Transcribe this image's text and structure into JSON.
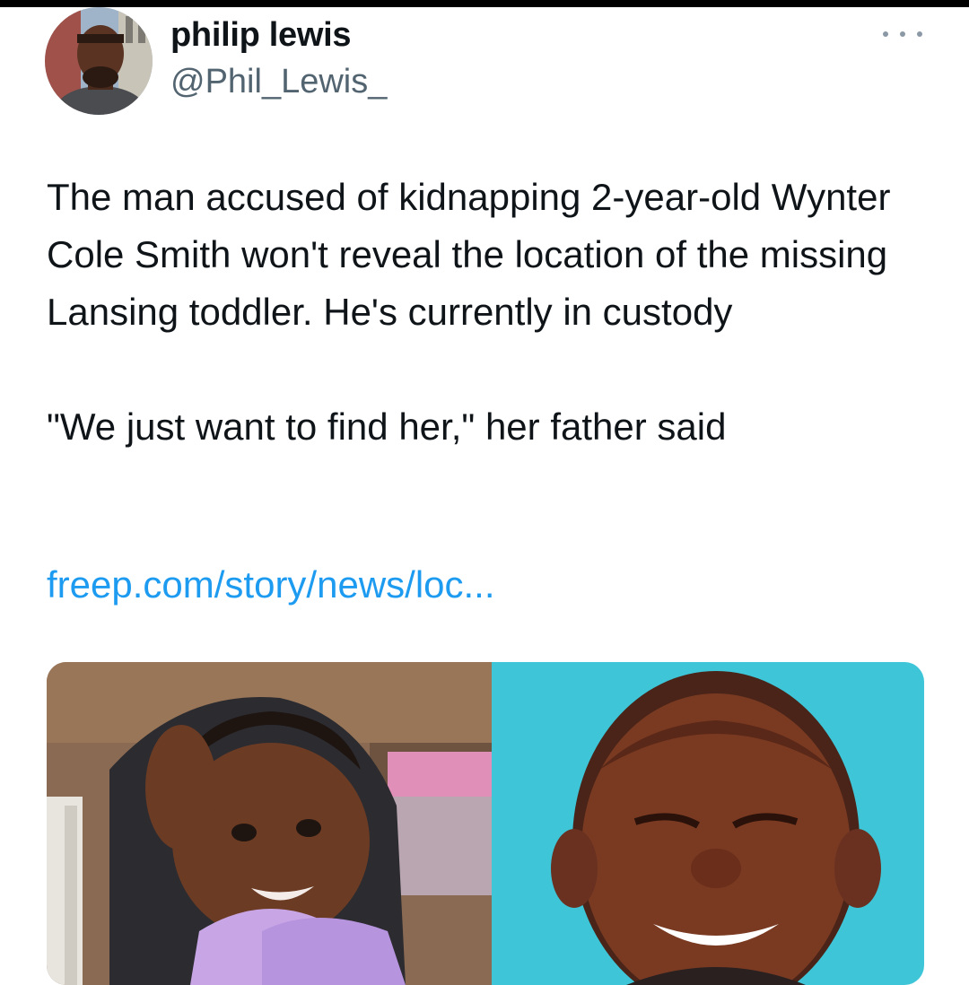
{
  "tweet": {
    "author": {
      "display_name": "philip lewis",
      "handle": "@Phil_Lewis_"
    },
    "text_paragraph_1": "The man accused of kidnapping 2-year-old Wynter Cole Smith won't reveal the location of the missing Lansing toddler. He's currently in custody",
    "text_paragraph_2": "\"We just want to find her,\" her father said",
    "link_text": "freep.com/story/news/loc...",
    "media": [
      {
        "kind": "photo",
        "subject": "toddler-photo"
      },
      {
        "kind": "photo",
        "subject": "man-photo"
      }
    ]
  },
  "icons": {
    "more": "more-horizontal-icon"
  },
  "colors": {
    "text": "#0f1419",
    "secondary_text": "#536471",
    "link": "#1d9bf0",
    "background": "#ffffff"
  }
}
